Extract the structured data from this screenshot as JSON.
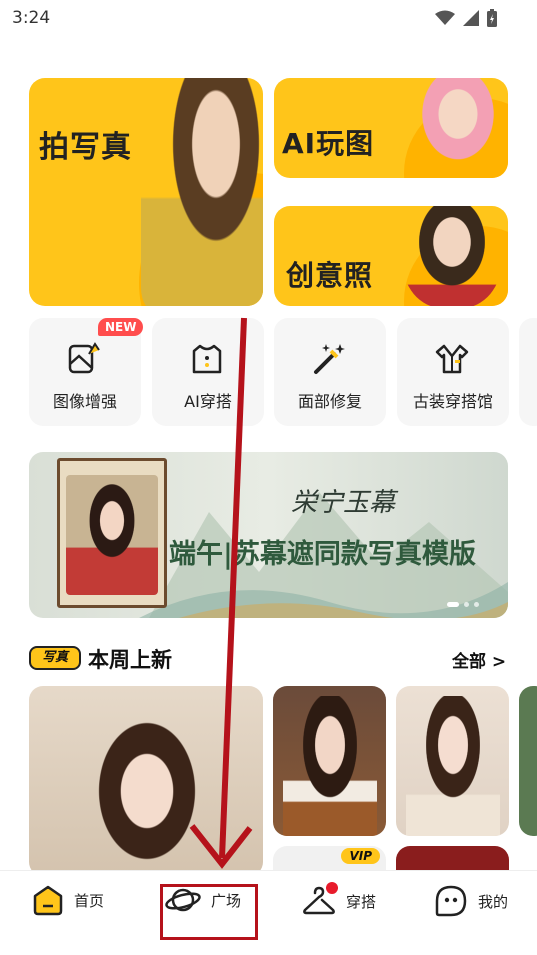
{
  "status_bar": {
    "time": "3:24"
  },
  "feature_cards": {
    "photo_shoot": "拍写真",
    "ai_play": "AI玩图",
    "creative_photo": "创意照"
  },
  "tools": [
    {
      "label": "图像增强",
      "icon": "image-enhance-icon",
      "badge": "NEW"
    },
    {
      "label": "AI穿搭",
      "icon": "shirt-icon"
    },
    {
      "label": "面部修复",
      "icon": "magic-wand-icon"
    },
    {
      "label": "古装穿搭馆",
      "icon": "costume-icon"
    }
  ],
  "banner": {
    "logo_text": "栄宁玉幕",
    "caption": "端午|苏幕遮同款写真模版",
    "page_indicator": {
      "count": 3,
      "active": 0
    }
  },
  "section": {
    "badge": "写真",
    "title": "本周上新",
    "all_link": "全部 >"
  },
  "photos": [
    {
      "badge": ""
    },
    {
      "badge": ""
    },
    {
      "badge": ""
    },
    {
      "badge": "VIP"
    }
  ],
  "nav": [
    {
      "label": "首页",
      "icon": "home-icon"
    },
    {
      "label": "广场",
      "icon": "planet-icon"
    },
    {
      "label": "穿搭",
      "icon": "hanger-icon",
      "dot": true
    },
    {
      "label": "我的",
      "icon": "profile-icon"
    }
  ],
  "colors": {
    "accent": "#ffc51a",
    "annotation": "#b5121b",
    "badge_red": "#ff4d4d"
  }
}
